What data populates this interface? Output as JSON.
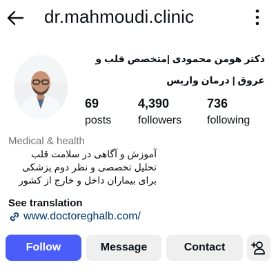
{
  "header": {
    "username": "dr.mahmoudi.clinic"
  },
  "profile": {
    "full_name": "دکتر هومن محمودی |متخصص قلب و عروق | درمان واریس",
    "stats": [
      {
        "value": "69",
        "label": "posts"
      },
      {
        "value": "4,390",
        "label": "followers"
      },
      {
        "value": "736",
        "label": "following"
      }
    ],
    "category": "Medical & health",
    "bio_lines": [
      "آموزش و آگاهی در سلامت قلب",
      "تحلیل تخصصی و نظر دوم پزشکی",
      "برای بیماران داخل و خارج از کشور"
    ],
    "see_translation": "See translation",
    "website": "www.doctoreghalb.com/"
  },
  "actions": {
    "follow_label": "Follow",
    "message_label": "Message",
    "contact_label": "Contact"
  },
  "icons": {
    "back": "arrow-left-icon",
    "more": "more-vertical-icon",
    "link": "link-icon",
    "add_person": "add-person-icon"
  },
  "colors": {
    "follow_button": "#4a5df9",
    "secondary_button": "#efefef",
    "link_text": "#00376b",
    "muted_text": "#737373"
  }
}
